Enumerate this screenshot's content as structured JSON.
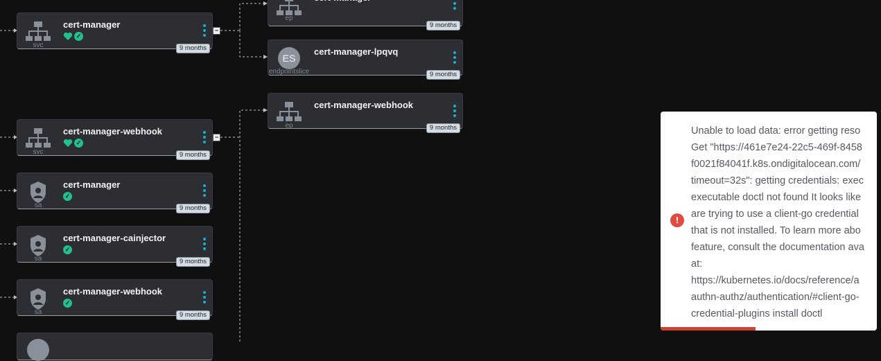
{
  "nodes": [
    {
      "id": "svc-cert-manager",
      "title": "cert-manager",
      "kind": "svc",
      "age": "9 months",
      "status": [
        "heart",
        "check"
      ]
    },
    {
      "id": "ep-cert-manager",
      "title": "cert-manager",
      "kind": "ep",
      "age": "9 months",
      "status": []
    },
    {
      "id": "es-cert-manager-lpqvq",
      "title": "cert-manager-lpqvq",
      "kind": "endpointslice",
      "badge": "ES",
      "age": "9 months",
      "status": []
    },
    {
      "id": "ep-cert-manager-webhook",
      "title": "cert-manager-webhook",
      "kind": "ep",
      "age": "9 months",
      "status": []
    },
    {
      "id": "svc-cert-manager-webhook",
      "title": "cert-manager-webhook",
      "kind": "svc",
      "age": "9 months",
      "status": [
        "heart",
        "check"
      ]
    },
    {
      "id": "sa-cert-manager",
      "title": "cert-manager",
      "kind": "sa",
      "age": "9 months",
      "status": [
        "check"
      ]
    },
    {
      "id": "sa-cert-manager-cainjector",
      "title": "cert-manager-cainjector",
      "kind": "sa",
      "age": "9 months",
      "status": [
        "check"
      ]
    },
    {
      "id": "sa-cert-manager-webhook",
      "title": "cert-manager-webhook",
      "kind": "sa",
      "age": "9 months",
      "status": [
        "check"
      ]
    }
  ],
  "toast": {
    "message": "Unable to load data: error getting reso\nGet \"https://461e7e24-22c5-469f-8458\nf0021f84041f.k8s.ondigitalocean.com/\ntimeout=32s\": getting credentials: exec\nexecutable doctl not found It looks like\nare trying to use a client-go credential\nthat is not installed. To learn more abo\nfeature, consult the documentation ava\nat:\nhttps://kubernetes.io/docs/reference/a\nauthn-authz/authentication/#client-go-\ncredential-plugins install doctl",
    "icon": "alert-icon",
    "progress": 0.44
  },
  "colors": {
    "accent": "#17b2c8",
    "ok": "#23c08e",
    "error": "#e04b3f",
    "background": "#101010",
    "node": "#2d2e33"
  }
}
